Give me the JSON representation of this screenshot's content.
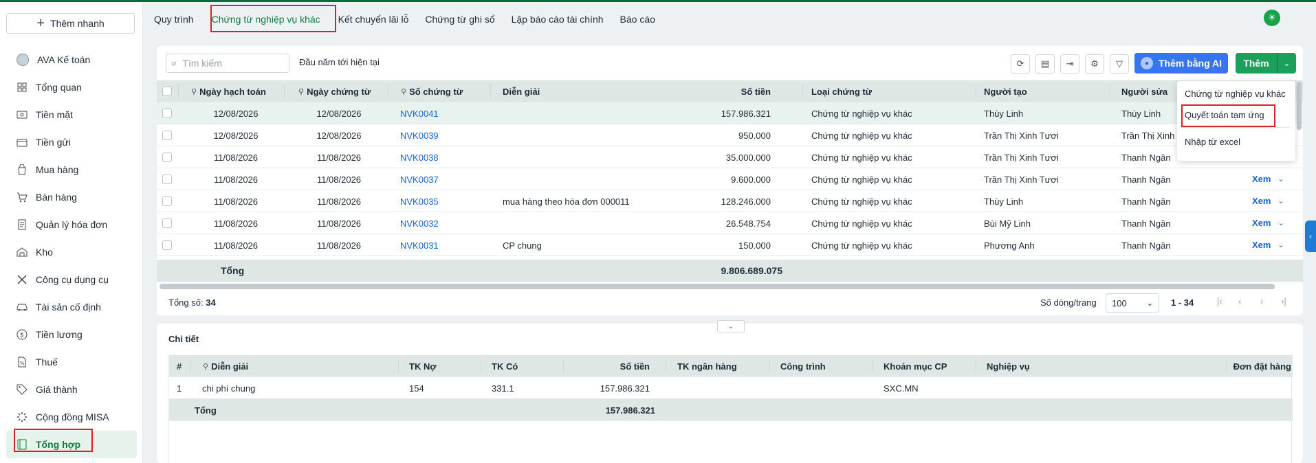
{
  "sidebar": {
    "quick_add": "Thêm nhanh",
    "items": [
      {
        "label": "AVA Kế toán",
        "icon": "avatar"
      },
      {
        "label": "Tổng quan",
        "icon": "dashboard-icon"
      },
      {
        "label": "Tiền mặt",
        "icon": "cash-icon"
      },
      {
        "label": "Tiền gửi",
        "icon": "bank-icon"
      },
      {
        "label": "Mua hàng",
        "icon": "shopping-bag-icon"
      },
      {
        "label": "Bán hàng",
        "icon": "cart-icon"
      },
      {
        "label": "Quản lý hóa đơn",
        "icon": "invoice-icon"
      },
      {
        "label": "Kho",
        "icon": "warehouse-icon"
      },
      {
        "label": "Công cụ dụng cụ",
        "icon": "tools-icon"
      },
      {
        "label": "Tài sản cố định",
        "icon": "car-icon"
      },
      {
        "label": "Tiền lương",
        "icon": "salary-icon"
      },
      {
        "label": "Thuế",
        "icon": "tax-icon"
      },
      {
        "label": "Giá thành",
        "icon": "price-tag-icon"
      },
      {
        "label": "Cộng đồng MISA",
        "icon": "community-icon"
      },
      {
        "label": "Tổng hợp",
        "icon": "summary-icon"
      }
    ]
  },
  "tabs": [
    "Quy trình",
    "Chứng từ nghiệp vụ khác",
    "Kết chuyển lãi lỗ",
    "Chứng từ ghi sổ",
    "Lập báo cáo tài chính",
    "Báo cáo"
  ],
  "toolbar": {
    "search_placeholder": "Tìm kiếm",
    "period": "Đầu năm tới hiện tại",
    "ai_button": "Thêm bằng AI",
    "add_button": "Thêm"
  },
  "menu": {
    "items": [
      "Chứng từ nghiệp vụ khác",
      "Quyết toán tạm ứng",
      "Nhập từ excel"
    ]
  },
  "grid": {
    "columns": [
      "Ngày hạch toán",
      "Ngày chứng từ",
      "Số chứng từ",
      "Diễn giải",
      "Số tiền",
      "Loại chứng từ",
      "Người tạo",
      "Người sửa"
    ],
    "rows": [
      {
        "posting_date": "12/08/2026",
        "doc_date": "12/08/2026",
        "doc_no": "NVK0041",
        "desc": "",
        "amount": "157.986.321",
        "type": "Chứng từ nghiệp vụ khác",
        "creator": "Thùy Linh",
        "editor": "Thùy Linh",
        "action": ""
      },
      {
        "posting_date": "12/08/2026",
        "doc_date": "12/08/2026",
        "doc_no": "NVK0039",
        "desc": "",
        "amount": "950.000",
        "type": "Chứng từ nghiệp vụ khác",
        "creator": "Trần Thị Xinh Tươi",
        "editor": "Trần Thị Xinh",
        "action": ""
      },
      {
        "posting_date": "11/08/2026",
        "doc_date": "11/08/2026",
        "doc_no": "NVK0038",
        "desc": "",
        "amount": "35.000.000",
        "type": "Chứng từ nghiệp vụ khác",
        "creator": "Trần Thị Xinh Tươi",
        "editor": "Thanh Ngân",
        "action": ""
      },
      {
        "posting_date": "11/08/2026",
        "doc_date": "11/08/2026",
        "doc_no": "NVK0037",
        "desc": "",
        "amount": "9.600.000",
        "type": "Chứng từ nghiệp vụ khác",
        "creator": "Trần Thị Xinh Tươi",
        "editor": "Thanh Ngân",
        "action": "Xem"
      },
      {
        "posting_date": "11/08/2026",
        "doc_date": "11/08/2026",
        "doc_no": "NVK0035",
        "desc": "mua hàng theo hóa đơn 000011",
        "amount": "128.246.000",
        "type": "Chứng từ nghiệp vụ khác",
        "creator": "Thùy Linh",
        "editor": "Thanh Ngân",
        "action": "Xem"
      },
      {
        "posting_date": "11/08/2026",
        "doc_date": "11/08/2026",
        "doc_no": "NVK0032",
        "desc": "",
        "amount": "26.548.754",
        "type": "Chứng từ nghiệp vụ khác",
        "creator": "Bùi Mỹ Linh",
        "editor": "Thanh Ngân",
        "action": "Xem"
      },
      {
        "posting_date": "11/08/2026",
        "doc_date": "11/08/2026",
        "doc_no": "NVK0031",
        "desc": "CP chung",
        "amount": "150.000",
        "type": "Chứng từ nghiệp vụ khác",
        "creator": "Phương Anh",
        "editor": "Thanh Ngân",
        "action": "Xem"
      }
    ],
    "total_label": "Tổng",
    "total_amount": "9.806.689.075"
  },
  "pager": {
    "count_label": "Tổng số:",
    "count_value": "34",
    "rows_per_page_label": "Số dòng/trang",
    "rows_per_page": "100",
    "range": "1 - 34"
  },
  "detail": {
    "title": "Chi tiết",
    "columns": [
      "#",
      "Diễn giải",
      "TK Nợ",
      "TK Có",
      "Số tiền",
      "TK ngân hàng",
      "Công trình",
      "Khoản mục CP",
      "Nghiệp vụ",
      "Đơn đặt hàng"
    ],
    "rows": [
      {
        "no": "1",
        "desc": "chi phí chung",
        "debit": "154",
        "credit": "331.1",
        "amount": "157.986.321",
        "bank": "",
        "project": "",
        "expense": "SXC.MN",
        "business": "",
        "order": ""
      }
    ],
    "total_label": "Tổng",
    "total_amount": "157.986.321"
  },
  "colors": {
    "accent_green": "#1aa05a",
    "ai_blue": "#3576f0",
    "highlight_red": "#d92027",
    "link_blue": "#1765d8"
  }
}
